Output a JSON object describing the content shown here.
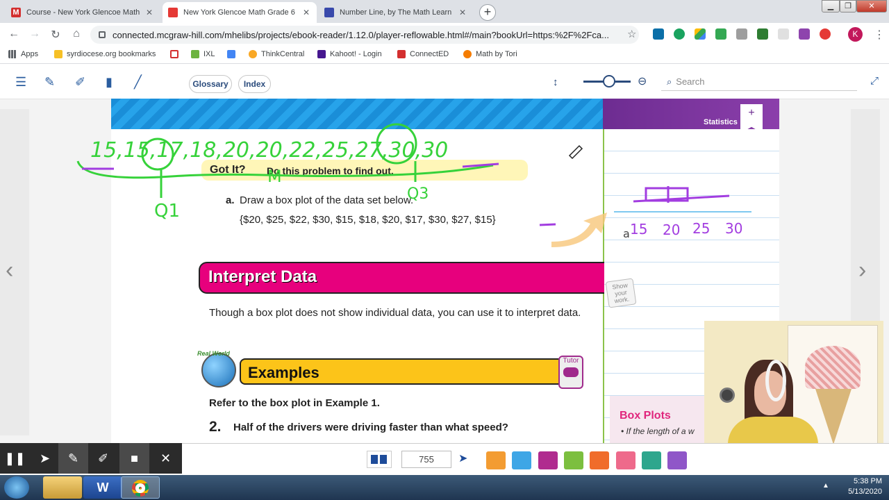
{
  "browser": {
    "tabs": [
      {
        "title": "Course - New York Glencoe Math",
        "fav_color": "#d32f2f",
        "fav_glyph": "M",
        "active": false
      },
      {
        "title": "New York Glencoe Math Grade 6",
        "fav_color": "#e53935",
        "fav_glyph": "",
        "active": true
      },
      {
        "title": "Number Line, by The Math Learn",
        "fav_color": "#3949ab",
        "fav_glyph": "",
        "active": false
      }
    ],
    "new_tab_label": "+",
    "url": "connected.mcgraw-hill.com/mhelibs/projects/ebook-reader/1.12.0/player-reflowable.html#/main?bookUrl=https:%2F%2Fca...",
    "profile_initial": "K",
    "bookmarks": [
      {
        "label": "Apps",
        "color": "#5f6368"
      },
      {
        "label": "syrdiocese.org bookmarks",
        "color": "#f6c026"
      },
      {
        "label": "",
        "color": "#d32f2f"
      },
      {
        "label": "IXL",
        "color": "#6cb33f"
      },
      {
        "label": "",
        "color": "#4285f4"
      },
      {
        "label": "ThinkCentral",
        "color": "#f9a825"
      },
      {
        "label": "Kahoot! - Login",
        "color": "#46178f"
      },
      {
        "label": "ConnectED",
        "color": "#d32f2f"
      },
      {
        "label": "Math by Tori",
        "color": "#f57c00"
      }
    ]
  },
  "reader": {
    "glossary_label": "Glossary",
    "index_label": "Index",
    "search_placeholder": "Search"
  },
  "page": {
    "statistics_tab": "Statistics",
    "plus_label": "+",
    "got_it": "Got It?",
    "got_it_instruction": "Do this problem to find out.",
    "item_letter": "a.",
    "item_text": "Draw a box plot of the data set below.",
    "data_set": "{$20, $25, $22, $30, $15, $18, $20, $17, $30, $27, $15}",
    "interpret_title": "Interpret Data",
    "interpret_body": "Though a box plot does not show individual data, you can use it to interpret data.",
    "real_world": "Real World",
    "examples_title": "Examples",
    "tutor_label": "Tutor",
    "refer_text": "Refer to the box plot in Example 1.",
    "q_number": "2.",
    "q_text": "Half of the drivers were driving faster than what speed?",
    "show_work": "Show your work.",
    "box_plots_title": "Box Plots",
    "box_plots_bullet": "• If the length of a w"
  },
  "ink": {
    "handwritten_list": "15,15,17,18,20,20,22,25,27,30,30",
    "label_q1": "Q1",
    "label_m": "M",
    "label_q3": "Q3",
    "notebook_letter": "a",
    "axis_labels": [
      "15",
      "20",
      "25",
      "30"
    ]
  },
  "bottom": {
    "page_number": "755"
  },
  "taskbar": {
    "time": "5:38 PM",
    "date": "5/13/2020"
  }
}
